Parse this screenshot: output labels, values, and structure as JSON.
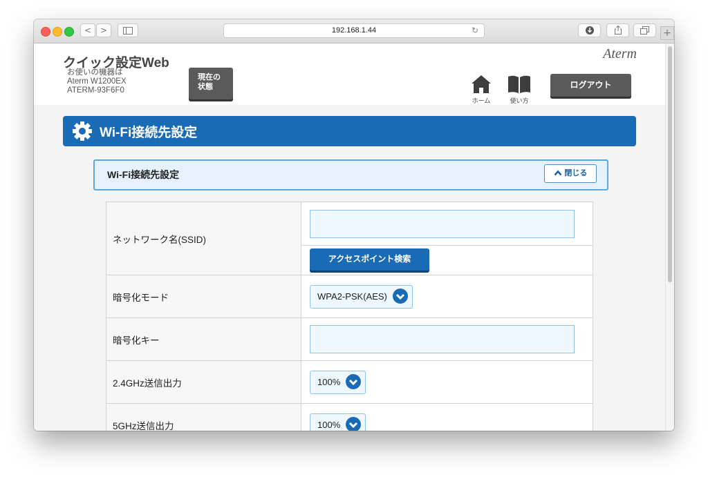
{
  "browser": {
    "url": "192.168.1.44",
    "nav_back": "<",
    "nav_forward": ">",
    "new_tab": "+"
  },
  "header": {
    "app_title": "クイック設定Web",
    "device_caption": "お使いの機器は",
    "device_model": "Aterm W1200EX",
    "device_id": "ATERM-93F6F0",
    "status_button": [
      "現在の",
      "状態"
    ],
    "brand": "Aterm",
    "home_label": "ホーム",
    "manual_label": "使い方",
    "logout_label": "ログアウト"
  },
  "section": {
    "title": "Wi-Fi接続先設定",
    "panel_title": "Wi-Fi接続先設定",
    "close_label": "閉じる"
  },
  "form": {
    "rows": [
      {
        "label": "ネットワーク名(SSID)",
        "value": "",
        "button": "アクセスポイント検索"
      },
      {
        "label": "暗号化モード",
        "value": "WPA2-PSK(AES)"
      },
      {
        "label": "暗号化キー",
        "value": ""
      },
      {
        "label": "2.4GHz送信出力",
        "value": "100%"
      },
      {
        "label": "5GHz送信出力",
        "value": "100%"
      }
    ]
  },
  "colors": {
    "accent_blue": "#1a6bb5",
    "input_bg": "#eef7fe",
    "dark_button": "#5a5a5a"
  }
}
